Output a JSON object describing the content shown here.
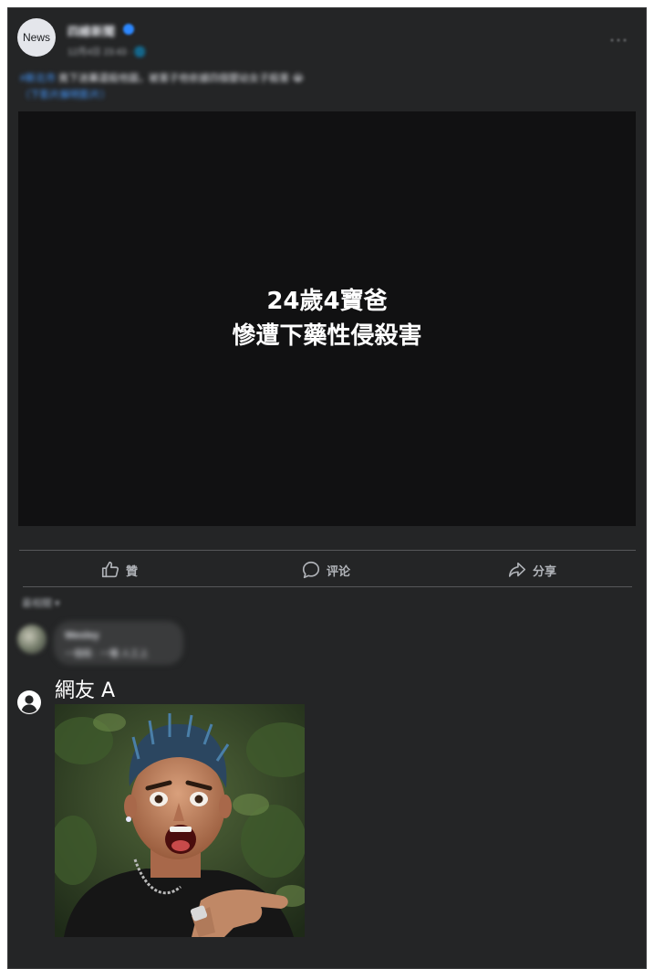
{
  "post": {
    "avatar_text": "News",
    "page_name": "四維新聞",
    "post_meta": "12月4日 23:43 · 🌐",
    "text_line_1_tag": "#新北市",
    "text_line_1": " 竟下迷藥還殺他圖，被害子他依據四個嬰幼女子殺害 😭",
    "text_line_2": "（下影片解明影片）"
  },
  "video": {
    "caption_line_1": "24歲4寶爸",
    "caption_line_2": "慘遭下藥性侵殺害"
  },
  "actions": {
    "like": "贊",
    "comment": "评论",
    "share": "分享"
  },
  "comments": {
    "sort_label": "最相關 ▾",
    "blurred_name": "Wesley",
    "blurred_text": "一個殺 · 一種 人工上",
    "commenter_name": "網友 A"
  },
  "colors": {
    "card_bg": "#242526",
    "video_bg": "#111112",
    "accent": "#2d88ff",
    "secondary_text": "#b0b3b8"
  }
}
